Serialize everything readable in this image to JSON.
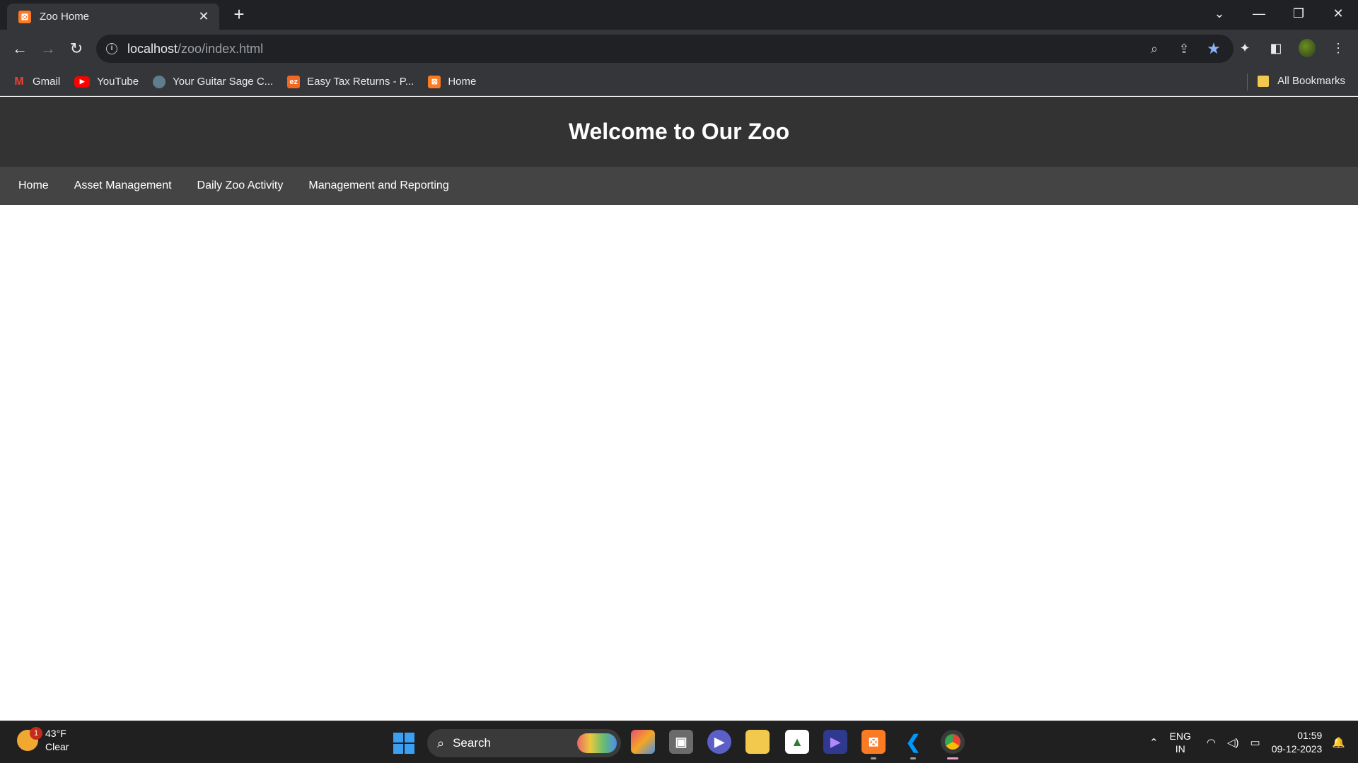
{
  "browser": {
    "tab_title": "Zoo Home",
    "url_host": "localhost",
    "url_path": "/zoo/index.html"
  },
  "bookmarks": [
    {
      "label": "Gmail",
      "icon": "gmail-icon"
    },
    {
      "label": "YouTube",
      "icon": "youtube-icon"
    },
    {
      "label": "Your Guitar Sage C...",
      "icon": "globe-icon"
    },
    {
      "label": "Easy Tax Returns - P...",
      "icon": "ez-icon"
    },
    {
      "label": "Home",
      "icon": "xampp-icon"
    }
  ],
  "all_bookmarks_label": "All Bookmarks",
  "page": {
    "title": "Welcome to Our Zoo",
    "nav": [
      "Home",
      "Asset Management",
      "Daily Zoo Activity",
      "Management and Reporting"
    ]
  },
  "taskbar": {
    "weather_temp": "43°F",
    "weather_desc": "Clear",
    "weather_badge": "1",
    "search_label": "Search",
    "lang_top": "ENG",
    "lang_bottom": "IN",
    "time": "01:59",
    "date": "09-12-2023"
  },
  "colors": {
    "header_bg": "#333333",
    "nav_bg": "#444444",
    "tab_icon": "#fb7a24"
  }
}
